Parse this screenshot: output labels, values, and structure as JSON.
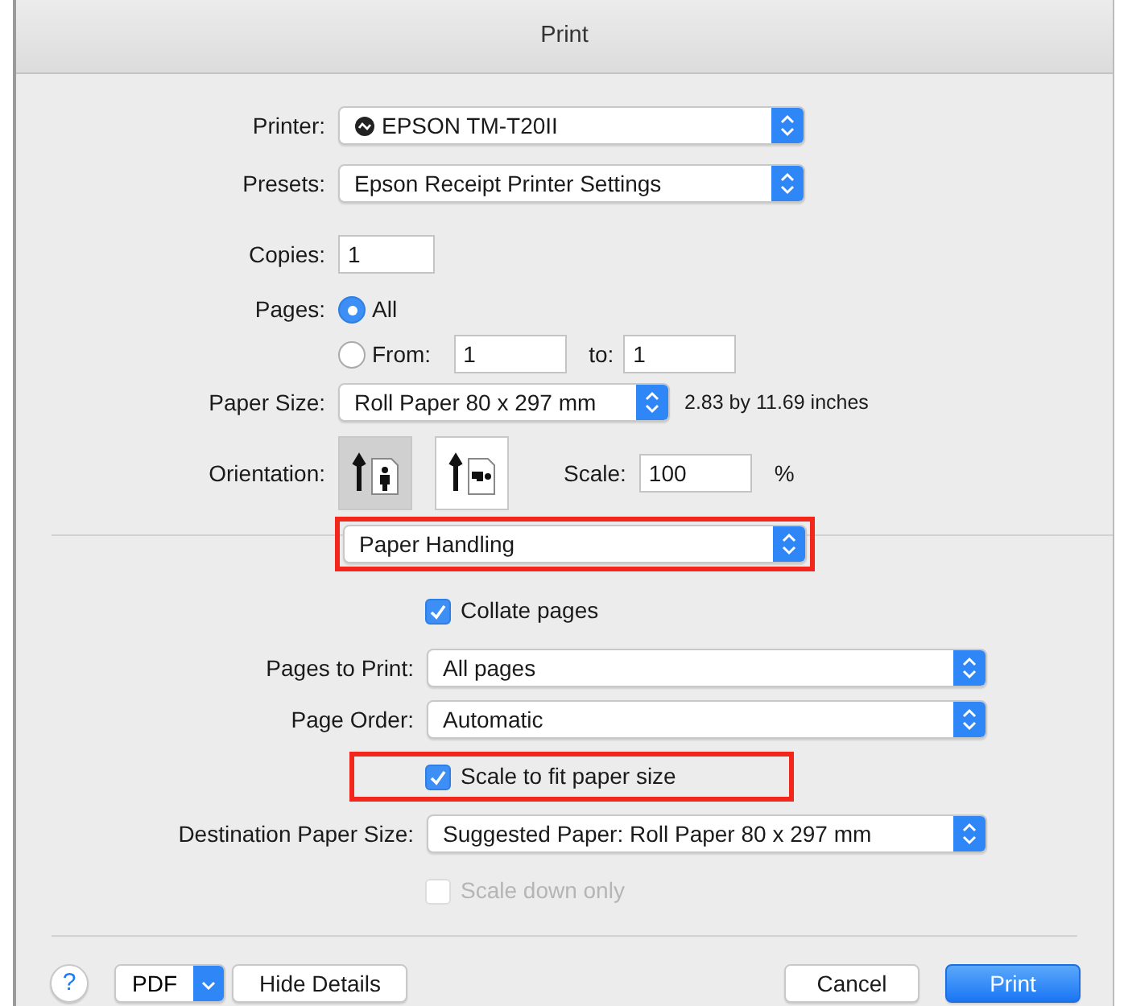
{
  "window": {
    "title": "Print"
  },
  "printer": {
    "label": "Printer:",
    "value": "EPSON TM-T20II"
  },
  "presets": {
    "label": "Presets:",
    "value": "Epson Receipt Printer Settings"
  },
  "copies": {
    "label": "Copies:",
    "value": "1"
  },
  "pages": {
    "label": "Pages:",
    "options": [
      {
        "label": "All",
        "selected": true
      },
      {
        "label": "From:",
        "selected": false
      }
    ],
    "from": "1",
    "to_label": "to:",
    "to": "1"
  },
  "paper_size": {
    "label": "Paper Size:",
    "value": "Roll Paper 80 x 297 mm",
    "dimensions": "2.83 by 11.69 inches"
  },
  "orientation": {
    "label": "Orientation:",
    "options": [
      {
        "kind": "portrait",
        "selected": true
      },
      {
        "kind": "landscape",
        "selected": false
      }
    ]
  },
  "scale": {
    "label": "Scale:",
    "value": "100",
    "unit": "%"
  },
  "section_menu": {
    "value": "Paper Handling",
    "highlighted": true
  },
  "settings": [
    {
      "kind": "checkbox",
      "label": "Collate pages",
      "checked": true,
      "disabled": false,
      "highlighted": false
    },
    {
      "kind": "select",
      "label": "Pages to Print:",
      "value": "All pages"
    },
    {
      "kind": "select",
      "label": "Page Order:",
      "value": "Automatic"
    },
    {
      "kind": "checkbox",
      "label": "Scale to fit paper size",
      "checked": true,
      "disabled": false,
      "highlighted": true
    },
    {
      "kind": "select",
      "label": "Destination Paper Size:",
      "value": "Suggested Paper: Roll Paper 80 x 297 mm"
    },
    {
      "kind": "checkbox",
      "label": "Scale down only",
      "checked": false,
      "disabled": true,
      "highlighted": false
    }
  ],
  "footer": {
    "help": "?",
    "pdf": "PDF",
    "details": "Hide Details",
    "cancel": "Cancel",
    "print": "Print"
  }
}
